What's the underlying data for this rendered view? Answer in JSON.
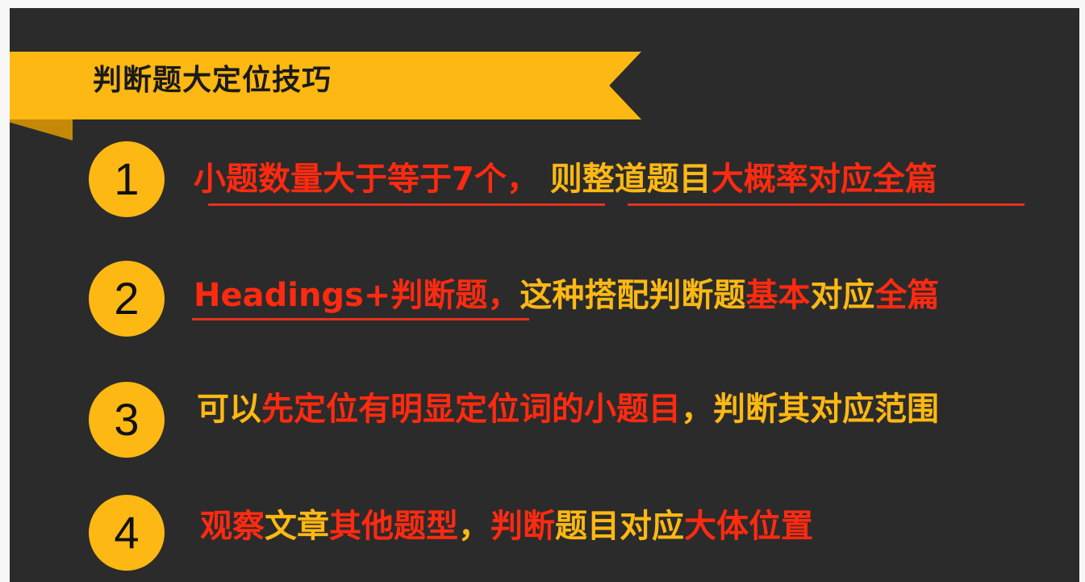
{
  "banner": {
    "title": "判断题大定位技巧"
  },
  "items": [
    {
      "number": "1",
      "segments": [
        {
          "text": "小题数量大于等于7个，",
          "color": "red"
        },
        {
          "text": " 则整道题目",
          "color": "yellow"
        },
        {
          "text": "大概率对应全篇",
          "color": "red"
        }
      ]
    },
    {
      "number": "2",
      "segments": [
        {
          "text": "Headings+判断题，",
          "color": "red"
        },
        {
          "text": "这种搭配判断题",
          "color": "yellow"
        },
        {
          "text": "基本",
          "color": "red"
        },
        {
          "text": "对应",
          "color": "yellow"
        },
        {
          "text": "全篇",
          "color": "red"
        }
      ]
    },
    {
      "number": "3",
      "segments": [
        {
          "text": "可以",
          "color": "yellow"
        },
        {
          "text": "先定位有明显定位词的小题目",
          "color": "red"
        },
        {
          "text": "，判断其对应范围",
          "color": "yellow"
        }
      ]
    },
    {
      "number": "4",
      "segments": [
        {
          "text": "观察",
          "color": "red"
        },
        {
          "text": "文章",
          "color": "yellow"
        },
        {
          "text": "其他题型",
          "color": "red"
        },
        {
          "text": "，",
          "color": "yellow"
        },
        {
          "text": "判断",
          "color": "red"
        },
        {
          "text": "题目对应",
          "color": "yellow"
        },
        {
          "text": "大体位置",
          "color": "red"
        }
      ]
    }
  ],
  "colors": {
    "background": "#2b2b2b",
    "accent": "#fdb813",
    "highlight": "#ff2a10"
  }
}
